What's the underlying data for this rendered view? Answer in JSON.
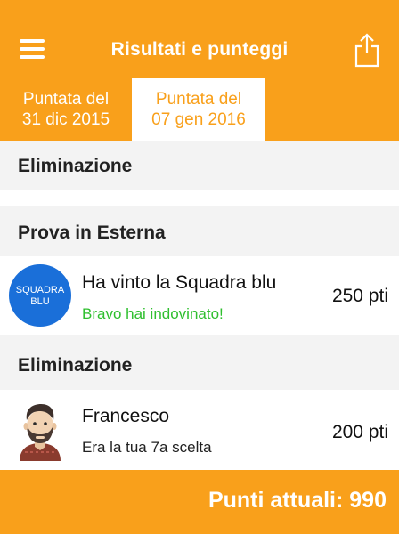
{
  "header": {
    "title": "Risultati e punteggi",
    "menu_icon": "hamburger-menu-icon",
    "share_icon": "share-icon"
  },
  "tabs": [
    {
      "line1": "Puntata del",
      "line2": "31 dic 2015",
      "active": false
    },
    {
      "line1": "Puntata del",
      "line2": "07 gen 2016",
      "active": true
    }
  ],
  "sections": [
    {
      "title": "Eliminazione"
    },
    {
      "title": "Prova in Esterna"
    },
    {
      "title": "Eliminazione"
    }
  ],
  "rows": [
    {
      "badge_line1": "SQUADRA",
      "badge_line2": "BLU",
      "badge_color": "#1a6fd9",
      "main": "Ha vinto la Squadra blu",
      "sub": "Bravo hai indovinato!",
      "sub_color": "#2fbf2f",
      "points": "250 pti"
    },
    {
      "avatar_icon": "bearded-man-avatar-icon",
      "main": "Francesco",
      "sub": "Era la tua 7a scelta",
      "points": "200 pti"
    }
  ],
  "footer": {
    "score": "Punti attuali: 990"
  },
  "colors": {
    "accent": "#f9a01b",
    "success": "#2fbf2f",
    "badge": "#1a6fd9"
  }
}
